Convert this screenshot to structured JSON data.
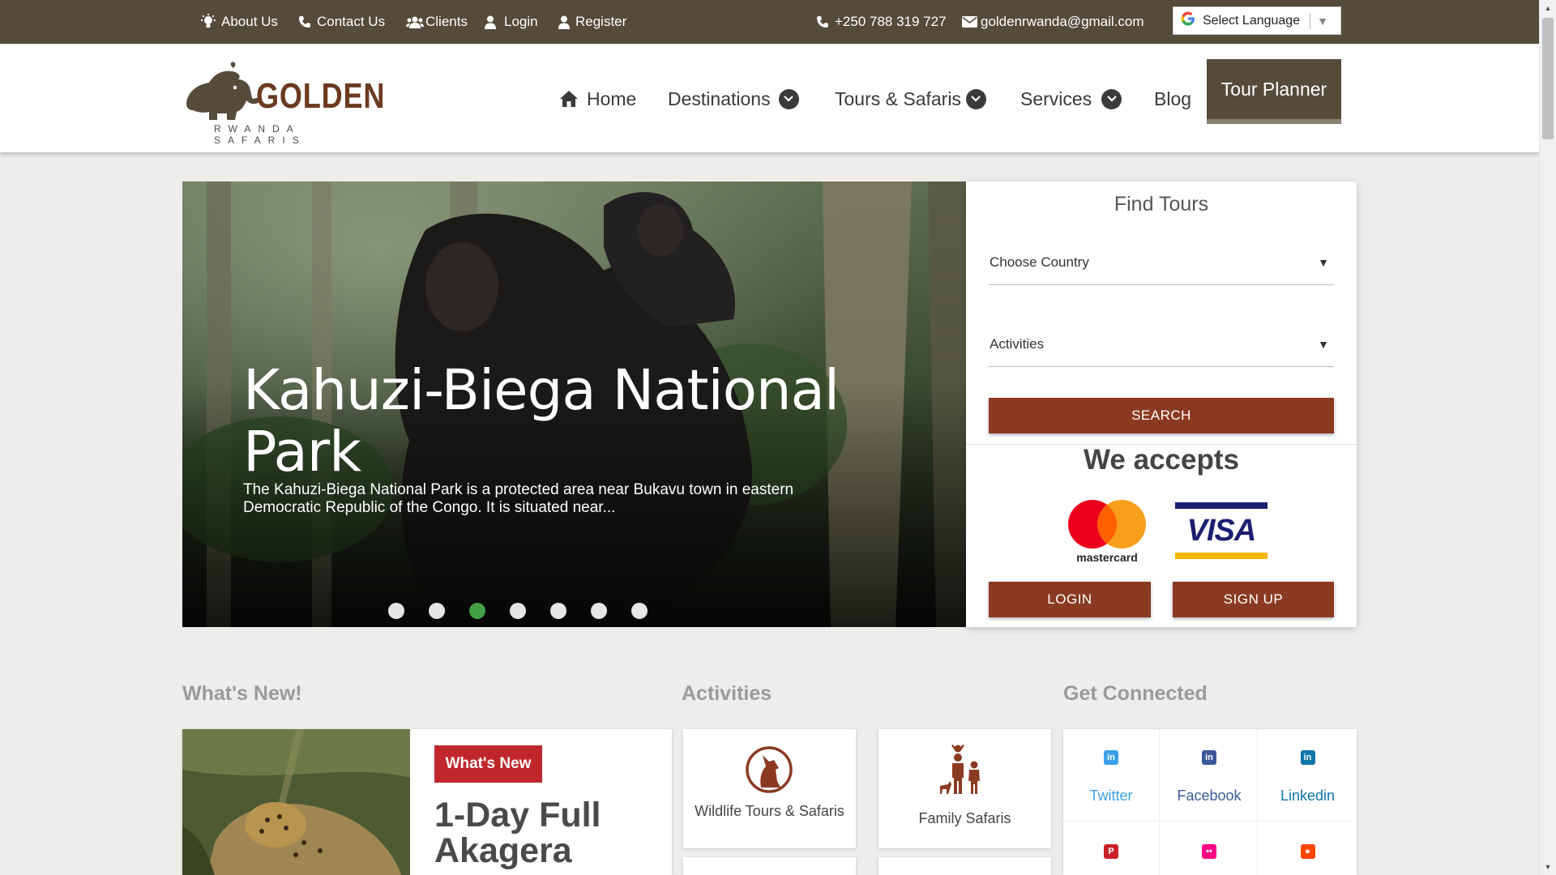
{
  "topbar": {
    "about": "About Us",
    "contact": "Contact Us",
    "clients": "Clients",
    "login": "Login",
    "register": "Register",
    "phone": "+250 788 319 727",
    "email": "goldenrwanda@gmail.com",
    "language": "Select Language"
  },
  "logo": {
    "name": "GOLDEN",
    "tagline": "RWANDA SAFARIS"
  },
  "nav": {
    "home": "Home",
    "destinations": "Destinations",
    "tours": "Tours & Safaris",
    "services": "Services",
    "blog": "Blog",
    "planner": "Tour Planner"
  },
  "hero": {
    "title": "Kahuzi-Biega National Park",
    "description": "The Kahuzi-Biega National Park is a protected area near Bukavu town in eastern Democratic Republic of the Congo. It is situated near...",
    "slide_count": 7,
    "active_slide": 3
  },
  "find_tours": {
    "title": "Find Tours",
    "country": "Choose Country",
    "activities": "Activities",
    "search": "SEARCH",
    "accepts": "We accepts",
    "mastercard": "mastercard",
    "visa": "VISA",
    "login": "LOGIN",
    "signup": "SIGN UP"
  },
  "sections": {
    "whats_new": "What's New!",
    "activities": "Activities",
    "connected": "Get Connected"
  },
  "news": {
    "badge": "What's New",
    "title": "1-Day Full Akagera"
  },
  "activities": [
    {
      "label": "Wildlife Tours & Safaris",
      "icon": "wolf-icon"
    },
    {
      "label": "Family Safaris",
      "icon": "family-icon"
    }
  ],
  "social": {
    "twitter": "Twitter",
    "facebook": "Facebook",
    "linkedin": "Linkedin"
  },
  "colors": {
    "topbar": "#564a3b",
    "brand_brown": "#8b3a22",
    "active_dot": "#43a047",
    "badge_red": "#c0272d"
  }
}
